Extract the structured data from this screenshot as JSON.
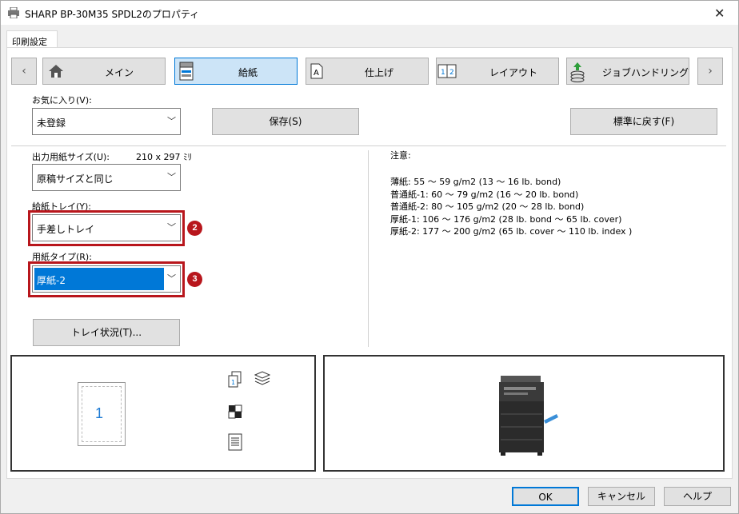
{
  "window": {
    "title": "SHARP BP-30M35 SPDL2のプロパティ",
    "close": "✕"
  },
  "tab": {
    "label": "印刷設定"
  },
  "nav": {
    "prev": "‹",
    "next": "›",
    "items": [
      {
        "label": "メイン",
        "icon": "home-icon"
      },
      {
        "label": "給紙",
        "icon": "printer-tray-icon"
      },
      {
        "label": "仕上げ",
        "icon": "finishing-a-icon"
      },
      {
        "label": "レイアウト",
        "icon": "layout-12-icon"
      },
      {
        "label": "ジョブハンドリング",
        "icon": "job-handling-icon"
      }
    ]
  },
  "favorites": {
    "label": "お気に入り(V):",
    "value": "未登録",
    "save": "保存(S)",
    "reset": "標準に戻す(F)"
  },
  "paper_size": {
    "label": "出力用紙サイズ(U):",
    "dims": "210 x 297 ﾐﾘ",
    "value": "原稿サイズと同じ"
  },
  "tray": {
    "label": "給紙トレイ(Y):",
    "value": "手差しトレイ",
    "badge": "2"
  },
  "paper_type": {
    "label": "用紙タイプ(R):",
    "value": "厚紙-2",
    "badge": "3"
  },
  "tray_status": {
    "label": "トレイ状況(T)..."
  },
  "notes": {
    "title": "注意:",
    "lines": [
      "薄紙: 55 ～ 59 g/m2 (13 ～ 16 lb. bond)",
      "普通紙-1: 60 ～ 79 g/m2 (16 ～ 20 lb. bond)",
      "普通紙-2: 80 ～ 105 g/m2 (20 ～ 28 lb. bond)",
      "厚紙-1: 106 ～ 176 g/m2 (28 lb. bond ～ 65 lb. cover)",
      "厚紙-2: 177 ～ 200 g/m2 (65 lb. cover ～ 110 lb. index )"
    ]
  },
  "preview": {
    "page_number": "1"
  },
  "footer": {
    "ok": "OK",
    "cancel": "キャンセル",
    "help": "ヘルプ"
  },
  "colors": {
    "accent": "#0078d7",
    "highlight": "#cce4f7",
    "badge_red": "#b8161c"
  }
}
